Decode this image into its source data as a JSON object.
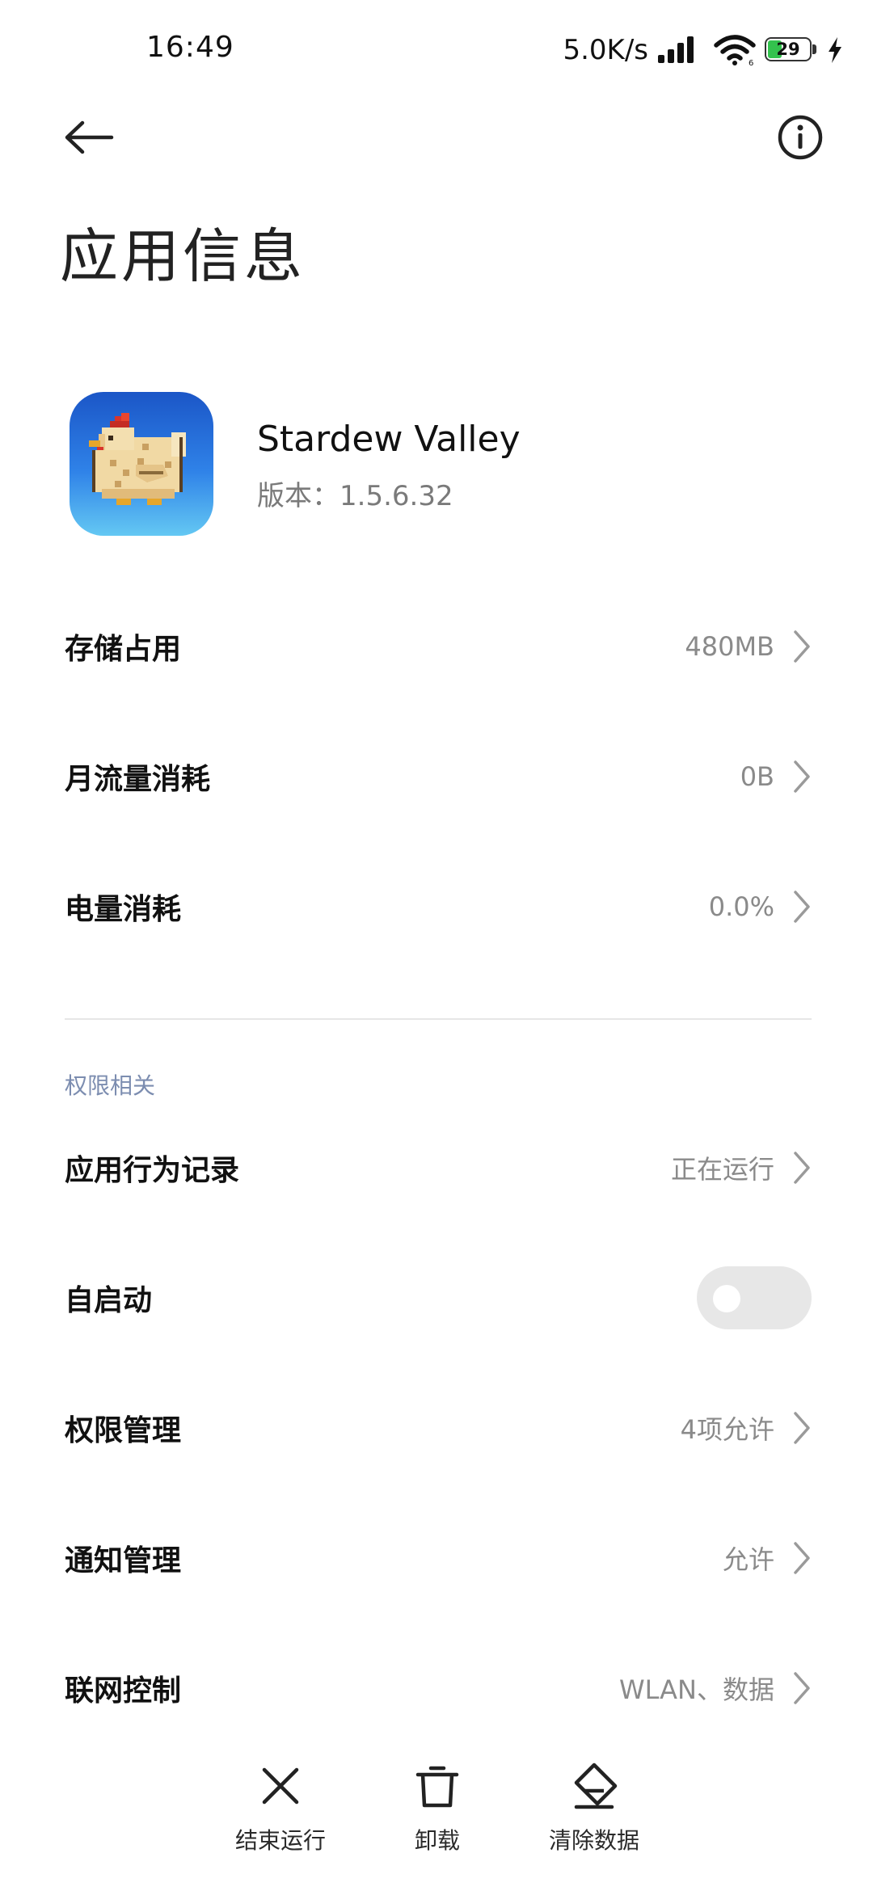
{
  "status_bar": {
    "time": "16:49",
    "net_speed": "5.0K/s",
    "signal_icon": "cellular-signal-icon",
    "wifi_icon": "wifi-icon",
    "battery_level": "29",
    "battery_fill_fraction": 0.29,
    "charging_icon": "charging-bolt-icon"
  },
  "header": {
    "back_icon": "arrow-left-icon",
    "info_icon": "info-circle-icon",
    "title": "应用信息"
  },
  "app": {
    "name": "Stardew Valley",
    "version": "版本：1.5.6.32",
    "icon": "stardew-chicken-app-icon"
  },
  "usage_rows": [
    {
      "label": "存储占用",
      "value": "480MB"
    },
    {
      "label": "月流量消耗",
      "value": "0B"
    },
    {
      "label": "电量消耗",
      "value": "0.0%"
    }
  ],
  "permissions": {
    "section_title": "权限相关",
    "rows": [
      {
        "label": "应用行为记录",
        "value": "正在运行"
      },
      {
        "label": "自启动",
        "toggle_on": false
      },
      {
        "label": "权限管理",
        "value": "4项允许"
      },
      {
        "label": "通知管理",
        "value": "允许"
      },
      {
        "label": "联网控制",
        "value": "WLAN、数据"
      }
    ]
  },
  "actions": [
    {
      "label": "结束运行",
      "icon": "close-x-icon"
    },
    {
      "label": "卸载",
      "icon": "trash-icon"
    },
    {
      "label": "清除数据",
      "icon": "eraser-icon"
    }
  ],
  "colors": {
    "accent_text": "#7c8db0",
    "toggle_off": "#e7e7e7",
    "battery_green": "#33c24d"
  }
}
